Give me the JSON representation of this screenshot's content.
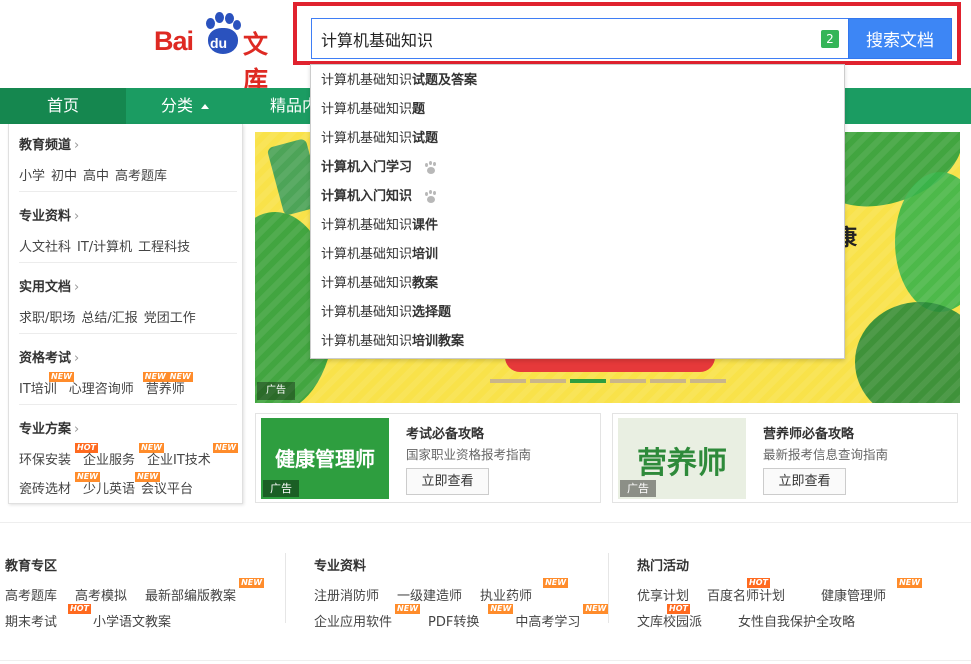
{
  "logo": {
    "bai": "Bai",
    "du": "du",
    "wenku": "文库"
  },
  "search": {
    "value": "计算机基础知识",
    "badge": "2",
    "button": "搜索文档"
  },
  "nav": {
    "home": "首页",
    "category": "分类",
    "fine": "精品内"
  },
  "categories": [
    {
      "title": "教育频道",
      "arrow": "›",
      "links": [
        "小学",
        "初中",
        "高中",
        "高考题库"
      ]
    },
    {
      "title": "专业资料",
      "arrow": "›",
      "links": [
        "人文社科",
        "IT/计算机",
        "工程科技"
      ]
    },
    {
      "title": "实用文档",
      "arrow": "›",
      "links": [
        "求职/职场",
        "总结/汇报",
        "党团工作"
      ]
    },
    {
      "title": "资格考试",
      "arrow": "›",
      "links": [
        "IT培训",
        "心理咨询师",
        "营养师"
      ]
    },
    {
      "title": "专业方案",
      "arrow": "›",
      "links": [
        "环保安装",
        "企业服务",
        "企业IT技术"
      ],
      "links2": [
        "瓷砖选材",
        "少儿英语",
        "会议平台"
      ]
    }
  ],
  "tags": {
    "new": "NEW",
    "hot": "HOT"
  },
  "banner": {
    "text": "康",
    "ad": "广告"
  },
  "cards": [
    {
      "img_text": "健康管理师",
      "ad": "广告",
      "title": "考试必备攻略",
      "subtitle": "国家职业资格报考指南",
      "button": "立即查看"
    },
    {
      "img_text": "营养师",
      "ad": "广告",
      "title": "营养师必备攻略",
      "subtitle": "最新报考信息查询指南",
      "button": "立即查看"
    }
  ],
  "bottom": [
    {
      "title": "教育专区",
      "row1": [
        "高考题库",
        "高考模拟",
        "最新部编版教案"
      ],
      "row2": [
        "期末考试",
        "小学语文教案"
      ]
    },
    {
      "title": "专业资料",
      "row1": [
        "注册消防师",
        "一级建造师",
        "执业药师"
      ],
      "row2": [
        "企业应用软件",
        "PDF转换",
        "中高考学习"
      ]
    },
    {
      "title": "热门活动",
      "row1": [
        "优享计划",
        "百度名师计划",
        "健康管理师"
      ],
      "row2": [
        "文库校园派",
        "女性自我保护全攻略"
      ]
    }
  ],
  "suggestions": [
    {
      "prefix": "计算机基础知识",
      "rest": "试题及答案",
      "paw": false
    },
    {
      "prefix": "计算机基础知识",
      "rest": "题",
      "paw": false
    },
    {
      "prefix": "计算机基础知识",
      "rest": "试题",
      "paw": false
    },
    {
      "prefix": "计算机",
      "rest": "入门学习",
      "paw": true
    },
    {
      "prefix": "计算机",
      "rest": "入门知识",
      "paw": true
    },
    {
      "prefix": "计算机基础知识",
      "rest": "课件",
      "paw": false
    },
    {
      "prefix": "计算机基础知识",
      "rest": "培训",
      "paw": false
    },
    {
      "prefix": "计算机基础知识",
      "rest": "教案",
      "paw": false
    },
    {
      "prefix": "计算机基础知识",
      "rest": "选择题",
      "paw": false
    },
    {
      "prefix": "计算机基础知识",
      "rest": "培训教案",
      "paw": false
    }
  ],
  "colors": {
    "brand_red": "#de2a23",
    "brand_blue": "#2a52be",
    "nav_green": "#1b9c62",
    "search_blue": "#3d86f5",
    "highlight_red": "#e0222e"
  }
}
